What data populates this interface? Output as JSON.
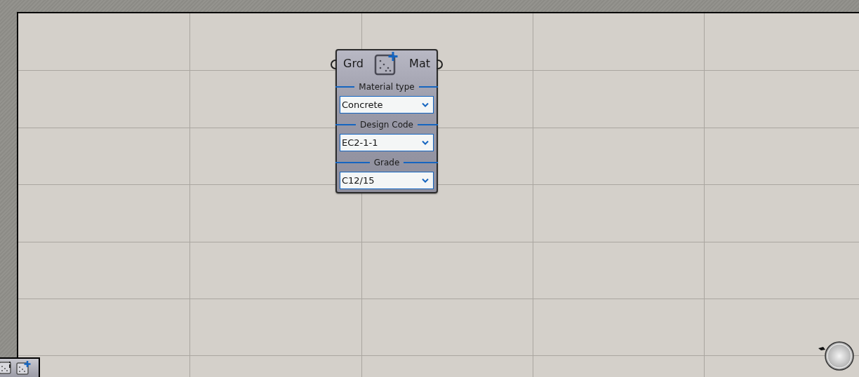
{
  "component": {
    "input": "Grd",
    "output": "Mat",
    "parameters": [
      {
        "label": "Material type",
        "value": "Concrete"
      },
      {
        "label": "Design Code",
        "value": "EC2-1-1"
      },
      {
        "label": "Grade",
        "value": "C12/15"
      }
    ]
  }
}
